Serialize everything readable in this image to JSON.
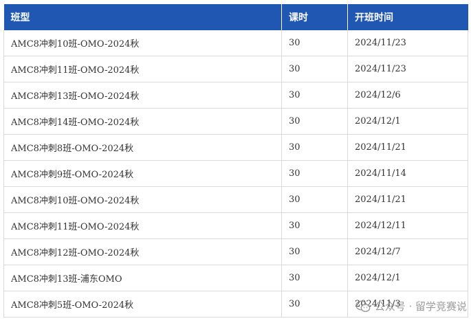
{
  "table": {
    "headers": [
      "班型",
      "课时",
      "开班时间"
    ],
    "rows": [
      [
        "AMC8冲刺10班-OMO-2024秋",
        "30",
        "2024/11/23"
      ],
      [
        "AMC8冲刺11班-OMO-2024秋",
        "30",
        "2024/11/23"
      ],
      [
        "AMC8冲刺13班-OMO-2024秋",
        "30",
        "2024/12/6"
      ],
      [
        "AMC8冲刺14班-OMO-2024秋",
        "30",
        "2024/12/1"
      ],
      [
        "AMC8冲刺8班-OMO-2024秋",
        "30",
        "2024/11/21"
      ],
      [
        "AMC8冲刺9班-OMO-2024秋",
        "30",
        "2024/11/14"
      ],
      [
        "AMC8冲刺10班-OMO-2024秋",
        "30",
        "2024/11/21"
      ],
      [
        "AMC8冲刺11班-OMO-2024秋",
        "30",
        "2024/12/11"
      ],
      [
        "AMC8冲刺12班-OMO-2024秋",
        "30",
        "2024/12/7"
      ],
      [
        "AMC8冲刺13班-浦东OMO",
        "30",
        "2024/12/1"
      ],
      [
        "AMC8冲刺5班-OMO-2024秋",
        "30",
        "2024/11/3"
      ]
    ]
  },
  "watermark": {
    "icon": "wechat-icon",
    "text": "公众号 · 留学竞赛说"
  },
  "colors": {
    "header_bg": "#1f57b3",
    "header_text": "#ffffff",
    "border": "#d9d9d9"
  }
}
